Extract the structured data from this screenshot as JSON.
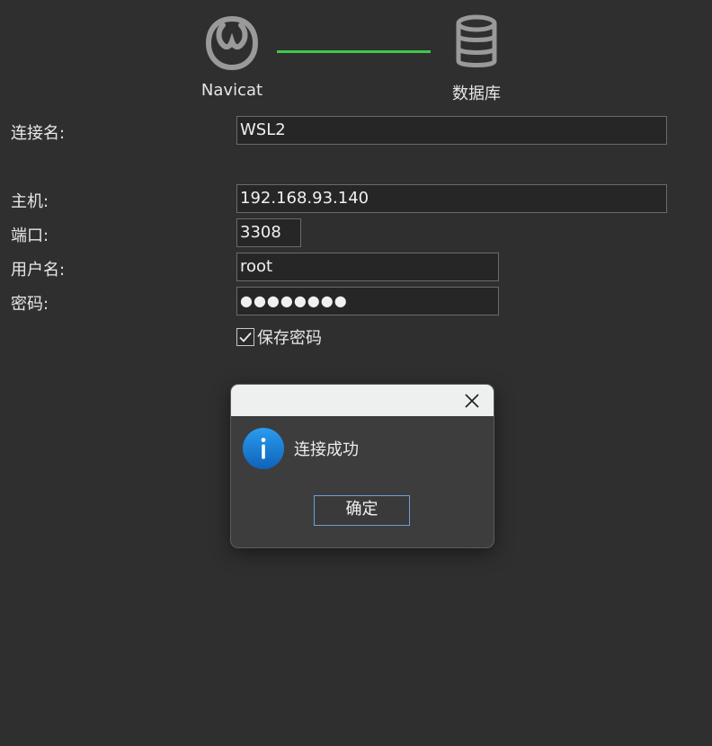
{
  "header": {
    "left_label": "Navicat",
    "right_label": "数据库",
    "connection_line_color": "#3dc94b",
    "left_icon": "navicat-logo-icon",
    "right_icon": "database-icon"
  },
  "form": {
    "connection_name_label": "连接名:",
    "connection_name_value": "WSL2",
    "host_label": "主机:",
    "host_value": "192.168.93.140",
    "port_label": "端口:",
    "port_value": "3308",
    "username_label": "用户名:",
    "username_value": "root",
    "password_label": "密码:",
    "password_masked": "●●●●●●●●",
    "save_password_label": "保存密码",
    "save_password_checked": true
  },
  "dialog": {
    "message": "连接成功",
    "ok_label": "确定",
    "icon": "info-icon",
    "icon_color": "#1a7fd6"
  }
}
